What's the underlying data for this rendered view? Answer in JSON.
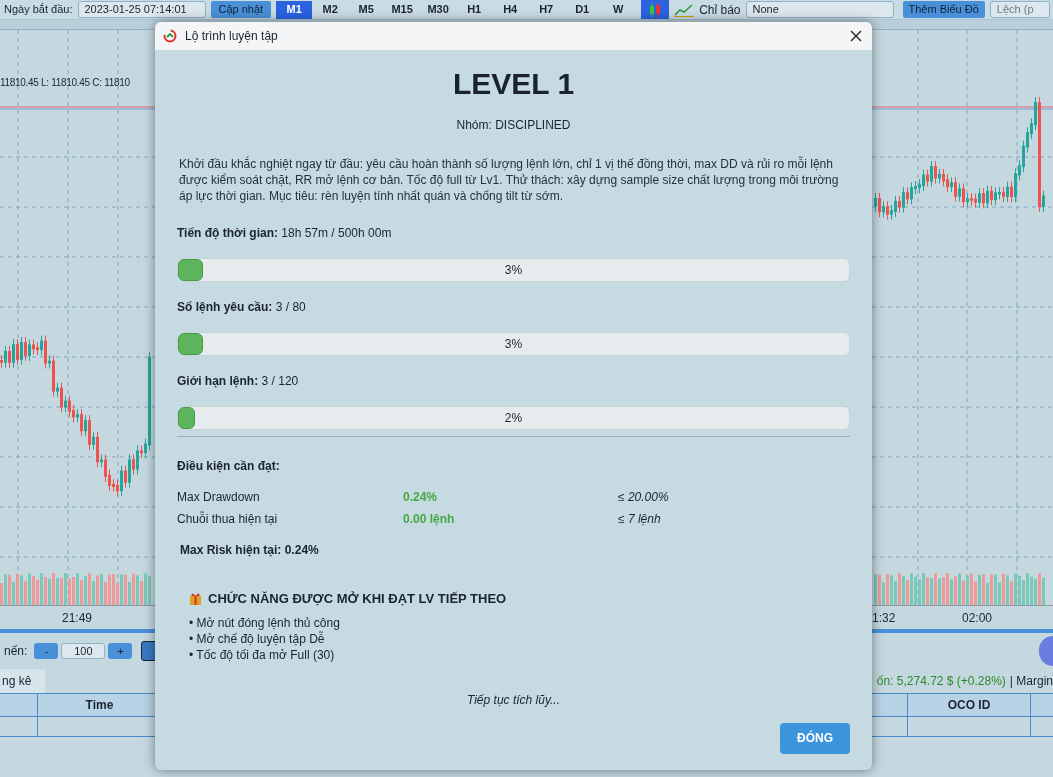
{
  "toolbar": {
    "start_date_label": "Ngày bắt đầu:",
    "start_date": "2023-01-25 07:14:01",
    "update_button": "Cập nhật",
    "timeframes": [
      {
        "label": "M1",
        "selected": true
      },
      {
        "label": "M2",
        "selected": false
      },
      {
        "label": "M5",
        "selected": false
      },
      {
        "label": "M15",
        "selected": false
      },
      {
        "label": "M30",
        "selected": false
      },
      {
        "label": "H1",
        "selected": false
      },
      {
        "label": "H4",
        "selected": false
      },
      {
        "label": "H7",
        "selected": false
      },
      {
        "label": "D1",
        "selected": false
      },
      {
        "label": "W",
        "selected": false
      }
    ],
    "indicator_label": "Chỉ báo",
    "indicator_value": "None",
    "add_chart_button": "Thêm Biểu Đồ",
    "offset_field": "Lệch (p"
  },
  "chart": {
    "ohlc_text": "11810.45 L: 11810.45 C: 11810",
    "time_labels": [
      "21:49",
      "1:32",
      "02:00"
    ]
  },
  "candles_control": {
    "label": "nến:",
    "decrement": "-",
    "count": "100",
    "increment": "+"
  },
  "bottom_tab": "ng kê",
  "status": {
    "balance": "ốn: 5,274.72 $ (+0.28%)",
    "margin": "| Margin"
  },
  "table": {
    "columns": [
      "Time",
      "OCO ID"
    ]
  },
  "dialog": {
    "title": "Lộ trình luyện tập",
    "heading": "LEVEL 1",
    "group": "Nhóm: DISCIPLINED",
    "description": "Khởi đầu khắc nghiệt ngay từ đầu: yêu cầu hoàn thành số lượng lệnh lớn, chỉ 1 vị thế đồng thời, max DD và rủi ro mỗi lệnh được kiểm soát chặt, RR mở lệnh cơ bản. Tốc độ full từ Lv1. Thử thách: xây dựng sample size chất lượng trong môi trường áp lực thời gian. Mục tiêu: rèn luyện tính nhất quán và chống tilt từ sớm.",
    "progress": [
      {
        "label": "Tiến độ thời gian:",
        "value": "18h 57m / 500h 00m",
        "level": 0.038,
        "percent": "3%"
      },
      {
        "label": "Số lệnh yêu cầu:",
        "value": "3 / 80",
        "level": 0.038,
        "percent": "3%"
      },
      {
        "label": "Giới hạn lệnh:",
        "value": "3 / 120",
        "level": 0.025,
        "percent": "2%"
      }
    ],
    "conditions_title": "Điều kiện cần đạt:",
    "conditions": [
      {
        "name": "Max Drawdown",
        "current": "0.24%",
        "limit": "≤ 20.00%"
      },
      {
        "name": "Chuỗi thua hiện tại",
        "current": "0.00 lệnh",
        "limit": "≤ 7 lệnh"
      }
    ],
    "max_risk": "Max Risk hiện tại: 0.24%",
    "unlocks_title": "CHỨC NĂNG ĐƯỢC MỞ KHI ĐẠT LV TIẾP THEO",
    "unlocks": [
      "• Mở nút đóng lệnh thủ công",
      "• Mở chế độ luyện tập Dễ",
      "• Tốc độ tối đa mở Full (30)"
    ],
    "footer": "Tiếp tục tích lũy...",
    "close_button": "ĐÓNG"
  }
}
